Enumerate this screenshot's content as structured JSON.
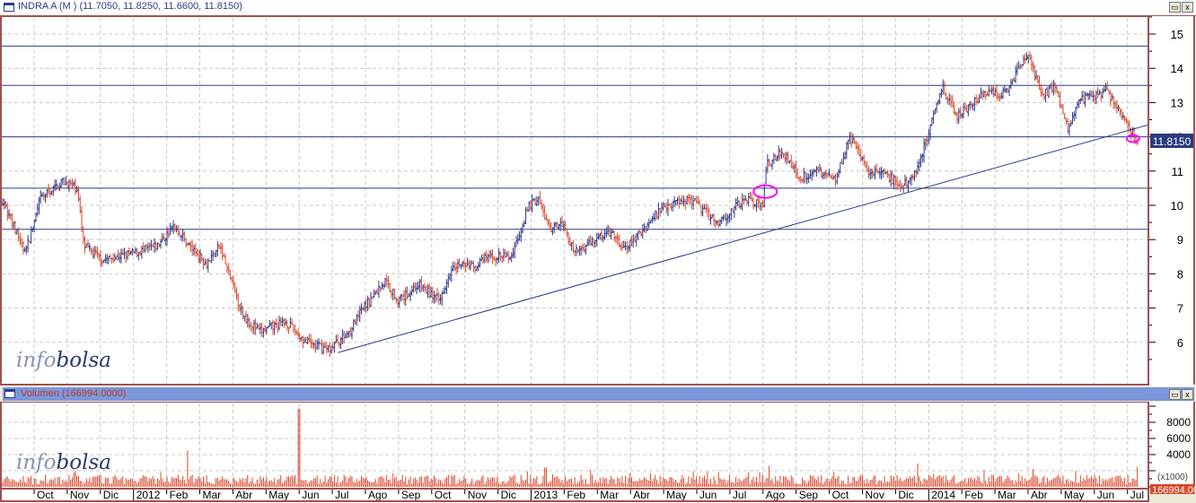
{
  "window": {
    "title": "INDRA A (M ) (11.7050, 11.8250, 11.6600, 11.8150)",
    "maximize_icon": "maximize-icon",
    "close_icon": "close-icon",
    "close_label": "x"
  },
  "volume_panel": {
    "title": "Volumen (166994.0000)",
    "readout": "166994.00",
    "unit": "(x1000)",
    "close_label": "x"
  },
  "watermark": {
    "part1": "info",
    "part2": "bolsa"
  },
  "colors": {
    "up_bar": "#2b3a8c",
    "down_bar": "#d9482a",
    "level_line": "#2b3a8c",
    "trend_line": "#2b3a8c",
    "highlight": "#ff00ff",
    "volume": "#d9482a",
    "volume_header": "#7b97dc",
    "price_box": "#2b3a7c"
  },
  "chart_data": [
    {
      "type": "ohlc",
      "title": "INDRA A (M )",
      "last": {
        "open": 11.705,
        "high": 11.825,
        "low": 11.66,
        "close": 11.815
      },
      "last_price_label": "11.8150",
      "ylim": [
        5,
        15.5
      ],
      "yticks": [
        "6",
        "7",
        "8",
        "9",
        "10",
        "11",
        "12",
        "13",
        "14",
        "15"
      ],
      "grid": true,
      "xticks": [
        {
          "label": "Oct",
          "date": "2011-10"
        },
        {
          "label": "Nov",
          "date": "2011-11"
        },
        {
          "label": "Dic",
          "date": "2011-12"
        },
        {
          "label": "2012",
          "date": "2012-01",
          "year": true
        },
        {
          "label": "Feb",
          "date": "2012-02"
        },
        {
          "label": "Mar",
          "date": "2012-03"
        },
        {
          "label": "Abr",
          "date": "2012-04"
        },
        {
          "label": "May",
          "date": "2012-05"
        },
        {
          "label": "Jun",
          "date": "2012-06"
        },
        {
          "label": "Jul",
          "date": "2012-07"
        },
        {
          "label": "Ago",
          "date": "2012-08"
        },
        {
          "label": "Sep",
          "date": "2012-09"
        },
        {
          "label": "Oct",
          "date": "2012-10"
        },
        {
          "label": "Nov",
          "date": "2012-11"
        },
        {
          "label": "Dic",
          "date": "2012-12"
        },
        {
          "label": "2013",
          "date": "2013-01",
          "year": true
        },
        {
          "label": "Feb",
          "date": "2013-02"
        },
        {
          "label": "Mar",
          "date": "2013-03"
        },
        {
          "label": "Abr",
          "date": "2013-04"
        },
        {
          "label": "May",
          "date": "2013-05"
        },
        {
          "label": "Jun",
          "date": "2013-06"
        },
        {
          "label": "Jul",
          "date": "2013-07"
        },
        {
          "label": "Ago",
          "date": "2013-08"
        },
        {
          "label": "Sep",
          "date": "2013-09"
        },
        {
          "label": "Oct",
          "date": "2013-10"
        },
        {
          "label": "Nov",
          "date": "2013-11"
        },
        {
          "label": "Dic",
          "date": "2013-12"
        },
        {
          "label": "2014",
          "date": "2014-01",
          "year": true
        },
        {
          "label": "Feb",
          "date": "2014-02"
        },
        {
          "label": "Mar",
          "date": "2014-03"
        },
        {
          "label": "Abr",
          "date": "2014-04"
        },
        {
          "label": "May",
          "date": "2014-05"
        },
        {
          "label": "Jun",
          "date": "2014-06"
        },
        {
          "label": "Jul",
          "date": "2014-07"
        }
      ],
      "price_path": [
        [
          "2011-09-02",
          10.2
        ],
        [
          "2011-09-23",
          8.6
        ],
        [
          "2011-10-07",
          10.2
        ],
        [
          "2011-10-27",
          10.7
        ],
        [
          "2011-11-10",
          10.5
        ],
        [
          "2011-11-16",
          8.8
        ],
        [
          "2011-12-04",
          8.4
        ],
        [
          "2012-01-01",
          8.6
        ],
        [
          "2012-01-22",
          8.8
        ],
        [
          "2012-02-08",
          9.4
        ],
        [
          "2012-02-22",
          8.8
        ],
        [
          "2012-03-07",
          8.3
        ],
        [
          "2012-03-19",
          8.8
        ],
        [
          "2012-04-10",
          6.8
        ],
        [
          "2012-04-25",
          6.3
        ],
        [
          "2012-05-19",
          6.6
        ],
        [
          "2012-06-07",
          6.0
        ],
        [
          "2012-06-28",
          5.8
        ],
        [
          "2012-07-16",
          6.3
        ],
        [
          "2012-07-29",
          7.0
        ],
        [
          "2012-08-19",
          7.8
        ],
        [
          "2012-09-01",
          7.2
        ],
        [
          "2012-09-19",
          7.7
        ],
        [
          "2012-10-08",
          7.2
        ],
        [
          "2012-10-20",
          8.3
        ],
        [
          "2012-11-10",
          8.2
        ],
        [
          "2012-11-22",
          8.5
        ],
        [
          "2012-12-13",
          8.5
        ],
        [
          "2012-12-29",
          10.0
        ],
        [
          "2013-01-07",
          10.2
        ],
        [
          "2013-01-19",
          9.2
        ],
        [
          "2013-01-28",
          9.6
        ],
        [
          "2013-02-10",
          8.6
        ],
        [
          "2013-02-28",
          9.0
        ],
        [
          "2013-03-13",
          9.2
        ],
        [
          "2013-03-25",
          8.7
        ],
        [
          "2013-04-10",
          9.2
        ],
        [
          "2013-05-01",
          10.0
        ],
        [
          "2013-05-25",
          10.2
        ],
        [
          "2013-06-20",
          9.5
        ],
        [
          "2013-07-16",
          10.2
        ],
        [
          "2013-08-01",
          10.0
        ],
        [
          "2013-08-04",
          11.2
        ],
        [
          "2013-08-19",
          11.6
        ],
        [
          "2013-09-04",
          10.8
        ],
        [
          "2013-09-19",
          11.0
        ],
        [
          "2013-10-07",
          10.8
        ],
        [
          "2013-10-19",
          12.0
        ],
        [
          "2013-11-07",
          11.0
        ],
        [
          "2013-11-22",
          10.9
        ],
        [
          "2013-12-07",
          10.5
        ],
        [
          "2013-12-19",
          11.0
        ],
        [
          "2013-12-28",
          11.8
        ],
        [
          "2014-01-13",
          13.5
        ],
        [
          "2014-01-25",
          12.6
        ],
        [
          "2014-02-07",
          12.9
        ],
        [
          "2014-02-25",
          13.3
        ],
        [
          "2014-03-07",
          13.2
        ],
        [
          "2014-03-19",
          13.8
        ],
        [
          "2014-04-01",
          14.4
        ],
        [
          "2014-04-13",
          13.2
        ],
        [
          "2014-04-25",
          13.5
        ],
        [
          "2014-05-07",
          12.3
        ],
        [
          "2014-05-16",
          13.0
        ],
        [
          "2014-05-28",
          13.2
        ],
        [
          "2014-06-13",
          13.3
        ],
        [
          "2014-06-22",
          12.8
        ],
        [
          "2014-07-01",
          12.4
        ],
        [
          "2014-07-10",
          11.815
        ]
      ],
      "horizontal_levels": [
        14.65,
        13.5,
        12.0,
        10.5,
        9.3
      ],
      "trend_line": [
        [
          "2012-07-06",
          5.7
        ],
        [
          "2014-07-20",
          12.35
        ]
      ],
      "highlights": [
        [
          "2013-08-03",
          10.4
        ],
        [
          "2014-07-06",
          11.95
        ]
      ]
    },
    {
      "type": "bar",
      "title": "Volumen",
      "ylabel": "(x1000)",
      "yticks": [
        "4000",
        "6000",
        "8000"
      ],
      "ylim": [
        0,
        10500
      ],
      "grid": true,
      "typical_range": [
        300,
        1500
      ],
      "spikes": [
        [
          "2012-02-20",
          4500
        ],
        [
          "2012-06-01",
          9700
        ],
        [
          "2013-01-14",
          2400
        ],
        [
          "2013-02-25",
          2100
        ],
        [
          "2013-08-06",
          2600
        ],
        [
          "2013-12-21",
          2900
        ],
        [
          "2014-07-10",
          2500
        ]
      ]
    }
  ]
}
